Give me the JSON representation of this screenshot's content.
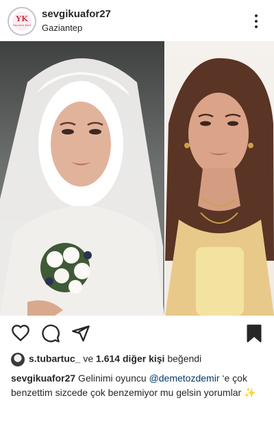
{
  "header": {
    "avatar_logo": "YK",
    "avatar_sub": "Yasemin Kurt",
    "username": "sevgikuafor27",
    "location": "Gaziantep"
  },
  "post": {
    "image_description_colors": {
      "left_bg": "#5e6160",
      "right_bg": "#f3eee7"
    }
  },
  "likes": {
    "liker": "s.tubartuc_",
    "connector": " ve ",
    "others": "1.614 diğer kişi",
    "suffix": " beğendi"
  },
  "caption": {
    "username": "sevgikuafor27",
    "text_1": " Gelinimi oyuncu ",
    "mention": "@demetozdemir",
    "text_2": " ‘e çok benzettim sizcede çok benzemiyor mu gelsin yorumlar ",
    "emoji": "✨"
  },
  "colors": {
    "text": "#262626",
    "mention": "#00376b"
  }
}
